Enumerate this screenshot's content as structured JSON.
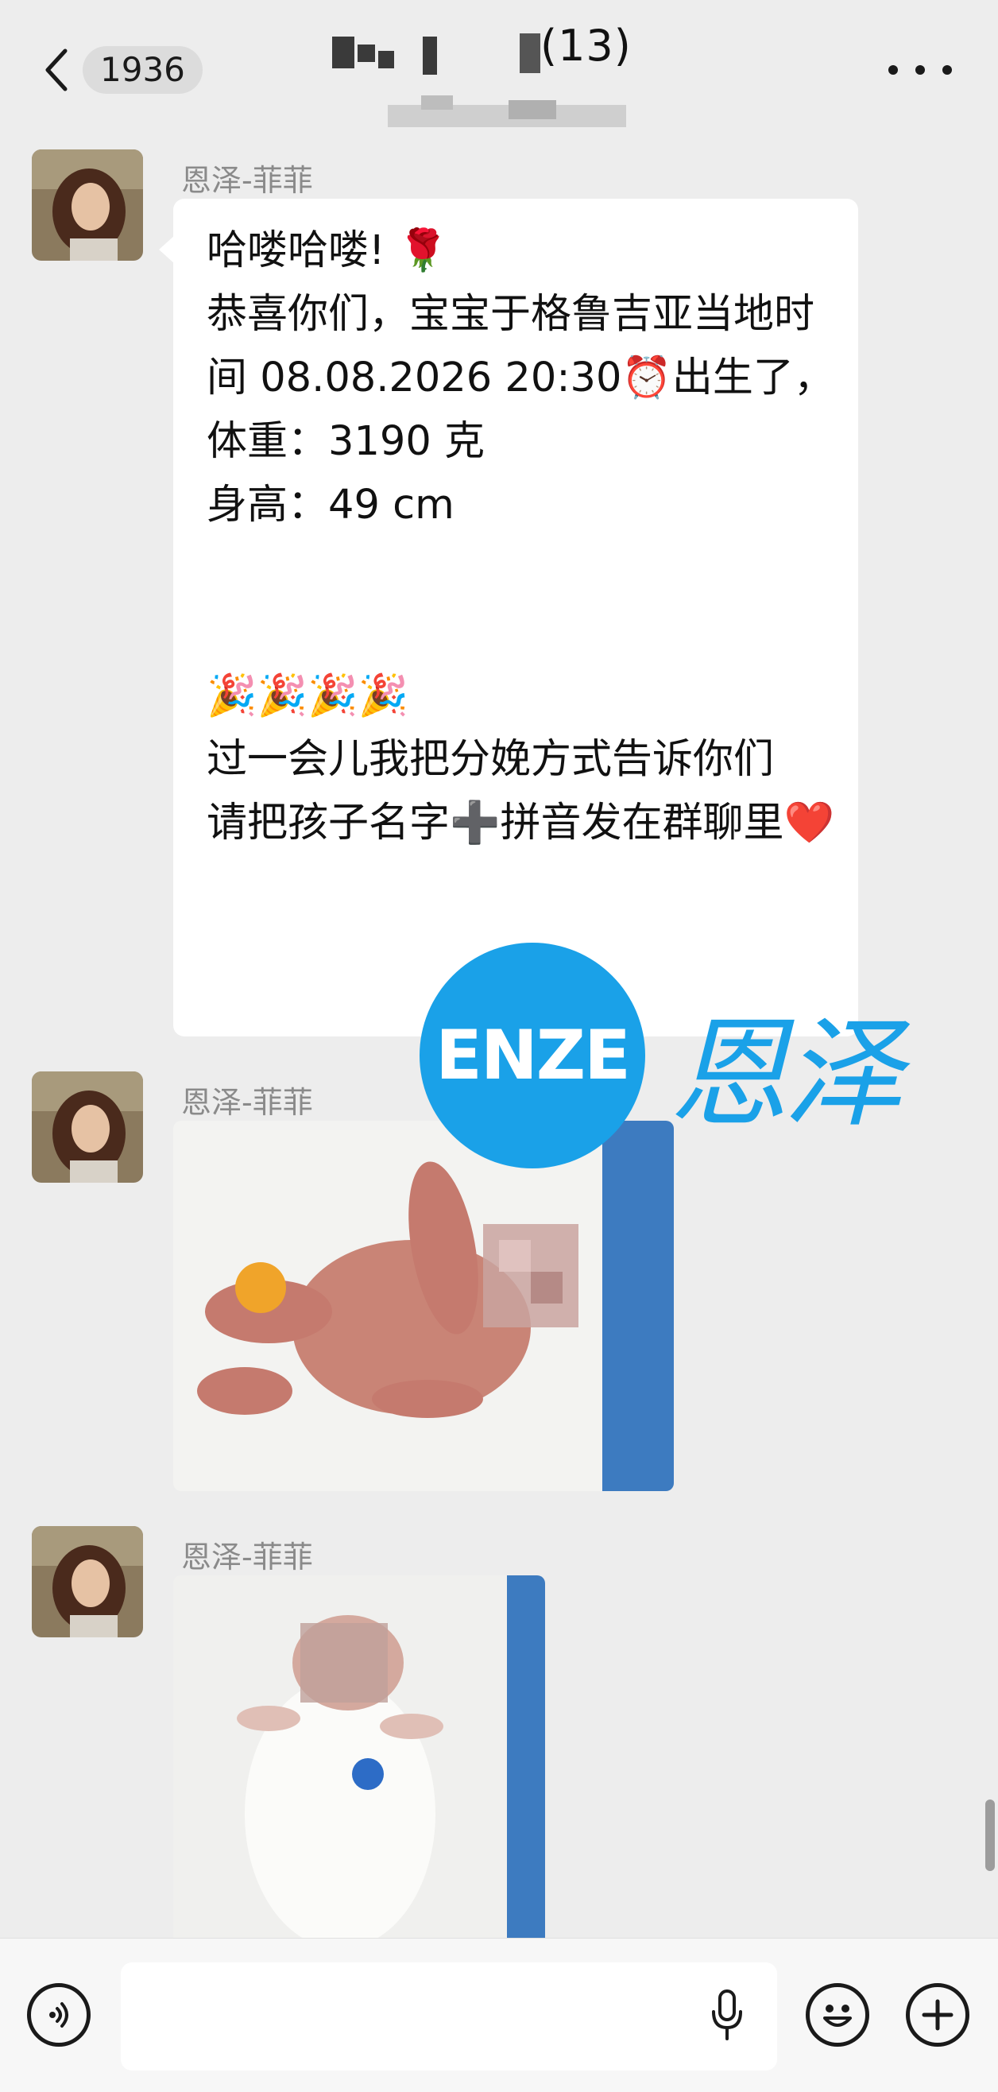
{
  "header": {
    "back_badge": "1936",
    "title_suffix": "(13)",
    "more_icon": "more-dots-icon"
  },
  "messages": [
    {
      "sender": "恩泽-菲菲",
      "type": "text",
      "text": "哈喽哈喽! 🌹\n恭喜你们，宝宝于格鲁吉亚当地时间 08.08.2026 20:30⏰出生了，\n体重：3190 克\n身高：49 cm\n\n\n🎉🎉🎉🎉\n过一会儿我把分娩方式告诉你们\n请把孩子名字➕拼音发在群聊里❤️"
    },
    {
      "sender": "恩泽-菲菲",
      "type": "image"
    },
    {
      "sender": "恩泽-菲菲",
      "type": "image"
    }
  ],
  "watermark": {
    "badge_text": "ENZE",
    "script_text": "恩泽",
    "color": "#1aa1e8"
  },
  "input_bar": {
    "input_value": "",
    "icons": [
      "voice-icon",
      "mic-icon",
      "emoji-icon",
      "plus-icon"
    ]
  }
}
